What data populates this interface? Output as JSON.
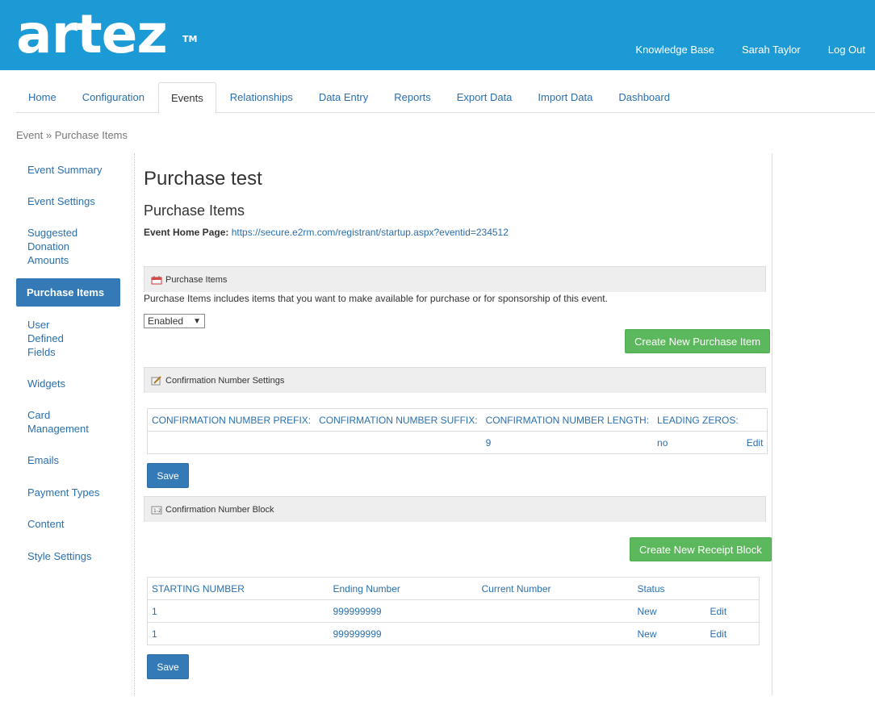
{
  "header": {
    "logo": "artez",
    "logo_tm": "TM",
    "links": [
      "Knowledge Base",
      "Sarah Taylor",
      "Log Out"
    ]
  },
  "tabs": [
    "Home",
    "Configuration",
    "Events",
    "Relationships",
    "Data Entry",
    "Reports",
    "Export Data",
    "Import Data",
    "Dashboard"
  ],
  "active_tab": "Events",
  "breadcrumb": "Event » Purchase Items",
  "sidebar": [
    "Event Summary",
    "Event Settings",
    "Suggested Donation Amounts",
    "Purchase Items",
    "User Defined Fields",
    "Widgets",
    "Card Management",
    "Emails",
    "Payment Types",
    "Content",
    "Style Settings"
  ],
  "active_sidebar": "Purchase Items",
  "main": {
    "title": "Purchase test",
    "subtitle": "Purchase Items",
    "home_label": "Event Home Page:",
    "home_url": "https://secure.e2rm.com/registrant/startup.aspx?eventid=234512",
    "purchase_panel": {
      "title": "Purchase Items",
      "description": "Purchase Items includes items that you want to make available for purchase or for sponsorship of this event.",
      "select_value": "Enabled",
      "select_arrow": "▼",
      "create_button": "Create New Purchase Item"
    },
    "confirmation_panel": {
      "title": "Confirmation Number Settings",
      "columns": [
        "CONFIRMATION NUMBER PREFIX:",
        "CONFIRMATION NUMBER SUFFIX:",
        "CONFIRMATION NUMBER LENGTH:",
        "LEADING ZEROS:",
        ""
      ],
      "row": [
        "",
        "",
        "9",
        "no",
        "Edit"
      ],
      "save_button": "Save"
    },
    "block_panel": {
      "title": "Confirmation Number Block",
      "create_button": "Create New Receipt Block",
      "columns": [
        "STARTING NUMBER",
        "Ending Number",
        "Current Number",
        "Status",
        ""
      ],
      "rows": [
        [
          "1",
          "999999999",
          "",
          "New",
          "Edit"
        ],
        [
          "1",
          "999999999",
          "",
          "New",
          "Edit"
        ]
      ],
      "save_button": "Save"
    }
  }
}
